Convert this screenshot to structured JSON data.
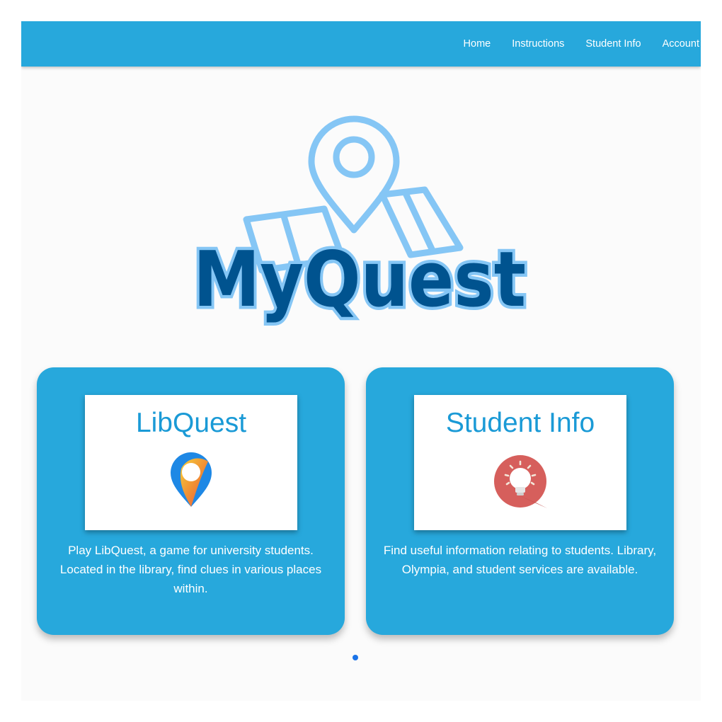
{
  "nav": {
    "links": [
      {
        "label": "Home"
      },
      {
        "label": "Instructions"
      },
      {
        "label": "Student Info"
      },
      {
        "label": "Account"
      }
    ]
  },
  "logo": {
    "text": "MyQuest"
  },
  "cards": [
    {
      "title": "LibQuest",
      "icon": "map-pin-icon",
      "description": "Play LibQuest, a game for university students. Located in the library, find clues in various places within."
    },
    {
      "title": "Student Info",
      "icon": "lightbulb-icon",
      "description": "Find useful information relating to students. Library, Olympia, and student services are available."
    }
  ],
  "carousel": {
    "pages": 1,
    "active": 0
  },
  "colors": {
    "navbar": "#27a8dc",
    "card": "#27a8dc",
    "title_text": "#1a9ad6",
    "logo_text": "#00538f",
    "logo_outline": "#85c6f5",
    "dot": "#1a73e8"
  }
}
